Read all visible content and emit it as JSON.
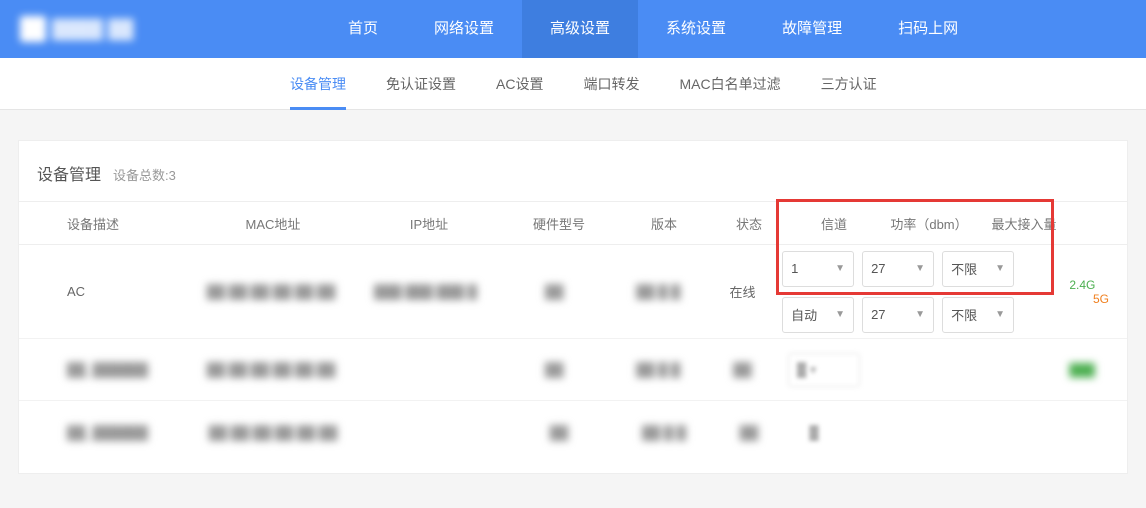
{
  "topNav": {
    "tabs": [
      "首页",
      "网络设置",
      "高级设置",
      "系统设置",
      "故障管理",
      "扫码上网"
    ],
    "activeIndex": 2
  },
  "subNav": {
    "tabs": [
      "设备管理",
      "免认证设置",
      "AC设置",
      "端口转发",
      "MAC白名单过滤",
      "三方认证"
    ],
    "activeIndex": 0
  },
  "panel": {
    "title": "设备管理",
    "sub": "设备总数:3"
  },
  "columns": {
    "desc": "设备描述",
    "mac": "MAC地址",
    "ip": "IP地址",
    "hw": "硬件型号",
    "ver": "版本",
    "status": "状态",
    "chan": "信道",
    "power": "功率（dbm）",
    "max": "最大接入量"
  },
  "rows": [
    {
      "desc": "AC",
      "mac": "██ ██ ██ ██ ██ ██",
      "ip": "███ ███ ███ █",
      "hw": "██",
      "ver": "██ █ █",
      "status": "在线",
      "selects": {
        "r24": {
          "chan": "1",
          "power": "27",
          "max": "不限"
        },
        "r5": {
          "chan": "自动",
          "power": "27",
          "max": "不限"
        }
      },
      "bands": {
        "g24": "2.4G",
        "g5": "5G"
      }
    },
    {
      "desc": "██_██████",
      "mac": "██ ██ ██ ██ ██ ██",
      "ip": "",
      "hw": "██",
      "ver": "██ █ █",
      "status": "██",
      "chanBlur": "█    ▾",
      "tag": "███"
    },
    {
      "desc": "██_██████",
      "mac": "██ ██ ██ ██ ██ ██",
      "ip": "",
      "hw": "██",
      "ver": "██ █ █",
      "status": "██",
      "chanBlur": "█"
    }
  ]
}
